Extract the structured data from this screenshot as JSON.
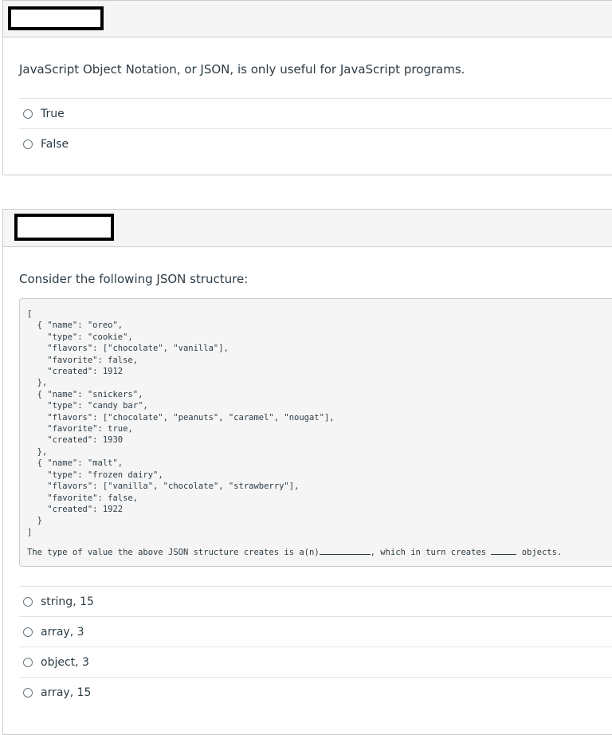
{
  "question1": {
    "text": "JavaScript Object Notation, or JSON, is only useful for JavaScript programs.",
    "answers": [
      "True",
      "False"
    ]
  },
  "question2": {
    "text": "Consider the following JSON structure:",
    "code": "[\n  { \"name\": \"oreo\",\n    \"type\": \"cookie\",\n    \"flavors\": [\"chocolate\", \"vanilla\"],\n    \"favorite\": false,\n    \"created\": 1912\n  },\n  { \"name\": \"snickers\",\n    \"type\": \"candy bar\",\n    \"flavors\": [\"chocolate\", \"peanuts\", \"caramel\", \"nougat\"],\n    \"favorite\": true,\n    \"created\": 1930\n  },\n  { \"name\": \"malt\",\n    \"type\": \"frozen dairy\",\n    \"flavors\": [\"vanilla\", \"chocolate\", \"strawberry\"],\n    \"favorite\": false,\n    \"created\": 1922\n  }\n]",
    "fill_part1": "The type of value the above JSON structure creates is a(n)",
    "fill_part2": ", which in turn creates ",
    "fill_part3": " objects.",
    "answers": [
      "string, 15",
      "array, 3",
      "object, 3",
      "array, 15"
    ]
  }
}
